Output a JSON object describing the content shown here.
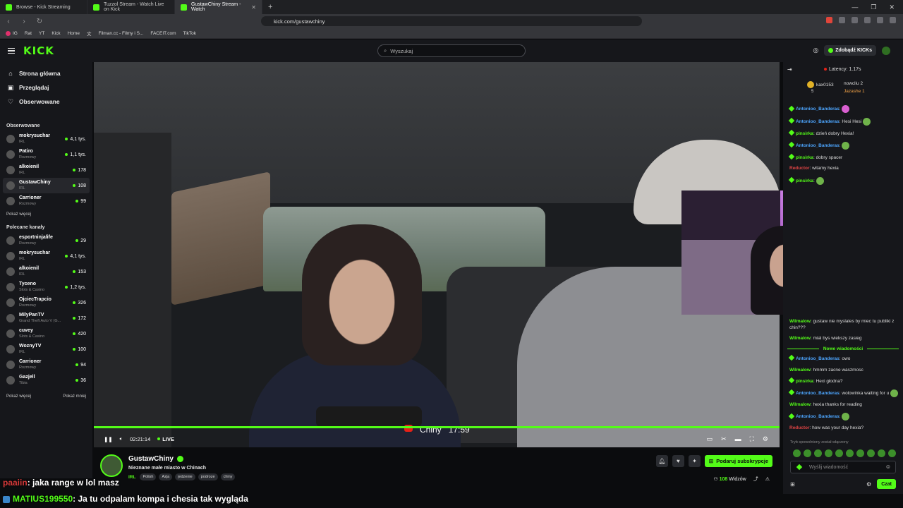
{
  "browser": {
    "tabs": [
      {
        "label": "Browse - Kick Streaming",
        "active": false
      },
      {
        "label": "Tuzzol Stream - Watch Live on Kick",
        "active": false
      },
      {
        "label": "GustawChiny Stream - Watch",
        "active": true
      }
    ],
    "url": "kick.com/gustawchiny",
    "bookmarks": [
      "IG",
      "Rat",
      "YT",
      "Kick",
      "Home",
      "文",
      "Filman.cc - Filmy i S...",
      "FACEIT.com",
      "TikTok"
    ]
  },
  "header": {
    "logo": "KICK",
    "search_placeholder": "Wyszukaj",
    "kicks_button": "Zdobądź KICKs"
  },
  "sidebar": {
    "nav": [
      {
        "label": "Strona główna",
        "icon": "home-icon"
      },
      {
        "label": "Przeglądaj",
        "icon": "browse-icon"
      },
      {
        "label": "Obserwowane",
        "icon": "heart-icon"
      }
    ],
    "followed_title": "Obserwowane",
    "followed": [
      {
        "name": "mokrysuchar",
        "category": "IRL",
        "viewers": "4,1 tys."
      },
      {
        "name": "Patiro",
        "category": "Rozmowy",
        "viewers": "1,1 tys."
      },
      {
        "name": "alkoienil",
        "category": "IRL",
        "viewers": "178"
      },
      {
        "name": "GustawChiny",
        "category": "IRL",
        "viewers": "108"
      },
      {
        "name": "Carrioner",
        "category": "Rozmowy",
        "viewers": "99"
      }
    ],
    "show_more_1": "Pokaż więcej",
    "recommended_title": "Polecane kanały",
    "recommended": [
      {
        "name": "esportninjalife",
        "category": "Rozmowy",
        "viewers": "29"
      },
      {
        "name": "mokrysuchar",
        "category": "IRL",
        "viewers": "4,1 tys."
      },
      {
        "name": "alkoienil",
        "category": "IRL",
        "viewers": "153"
      },
      {
        "name": "Tyceno",
        "category": "Slots & Casino",
        "viewers": "1,2 tys."
      },
      {
        "name": "OjciecTrapcio",
        "category": "Rozmowy",
        "viewers": "326"
      },
      {
        "name": "MilyPanTV",
        "category": "Grand Theft Auto V (G...",
        "viewers": "172"
      },
      {
        "name": "cuvey",
        "category": "Slots & Casino",
        "viewers": "420"
      },
      {
        "name": "WoznyTV",
        "category": "IRL",
        "viewers": "100"
      },
      {
        "name": "Carrioner",
        "category": "Rozmowy",
        "viewers": "94"
      },
      {
        "name": "Gazjell",
        "category": "Tibia",
        "viewers": "36"
      }
    ],
    "show_more_2": "Pokaż więcej",
    "show_less": "Pokaż mniej"
  },
  "player": {
    "time": "02:21:14",
    "live": "LIVE",
    "overlay_location": "Chiny",
    "overlay_clock": "17:59",
    "progress": 1.0
  },
  "stream": {
    "streamer": "GustawChiny",
    "title": "Nieznane małe miasto w Chinach",
    "category": "IRL",
    "tags": [
      "Polish",
      "Azja",
      "jedzenie",
      "podroze",
      "chiny"
    ],
    "subscribe_button": "Podaruj subskrypcje",
    "viewers_count": "108",
    "viewers_label": "Widzów"
  },
  "chat": {
    "latency": "Latency: 1.17s",
    "leaderboard": [
      {
        "name": "kax0153",
        "count": "5"
      },
      {
        "name": "nowcliu",
        "count": "2"
      },
      {
        "name": "Jazashe",
        "count": "1"
      }
    ],
    "messages": [
      {
        "user": "Antonioo_Banderas",
        "text": "",
        "cls": "u-ab",
        "badge": true,
        "emote": "pink"
      },
      {
        "user": "Antonioo_Banderas",
        "text": "Hesi Hesi",
        "cls": "u-ab",
        "badge": true,
        "emote": "green"
      },
      {
        "user": "pinsirka",
        "text": "dzień dobry Hexia!",
        "cls": "u-ps",
        "badge": true,
        "emote": ""
      },
      {
        "user": "Antonioo_Banderas",
        "text": "",
        "cls": "u-ab",
        "badge": true,
        "emote": "green"
      },
      {
        "user": "pinsirka",
        "text": "dobry spacer",
        "cls": "u-ps",
        "badge": true,
        "emote": ""
      },
      {
        "user": "Reductor",
        "text": "witamy hexia",
        "cls": "u-rd",
        "badge": false,
        "emote": ""
      },
      {
        "user": "pinsirka",
        "text": "",
        "cls": "u-ps",
        "badge": true,
        "emote": "green"
      }
    ],
    "messages_after": [
      {
        "user": "Wilmalow",
        "text": "gustaw nie myslales by miec tu publiki z chin???",
        "cls": "u-wl",
        "badge": false,
        "emote": ""
      },
      {
        "user": "Wilmalow",
        "text": "mial bys wiekszy zasieg",
        "cls": "u-wl",
        "badge": false,
        "emote": ""
      }
    ],
    "new_messages_label": "Nowe wiadomości",
    "messages_new": [
      {
        "user": "Antonioo_Banderas",
        "text": "owo",
        "cls": "u-ab",
        "badge": true,
        "emote": ""
      },
      {
        "user": "Wilmalow",
        "text": "hmmm zacne waszmosc",
        "cls": "u-wl",
        "badge": false,
        "emote": ""
      },
      {
        "user": "pinsirka",
        "text": "Hexi głodna?",
        "cls": "u-ps",
        "badge": true,
        "emote": ""
      },
      {
        "user": "Antonioo_Banderas",
        "text": "wolowinka waiting for u",
        "cls": "u-ab",
        "badge": true,
        "emote": "green"
      },
      {
        "user": "Wilmalow",
        "text": "hexia thanks for reading",
        "cls": "u-wl",
        "badge": false,
        "emote": ""
      },
      {
        "user": "Antonioo_Banderas",
        "text": "",
        "cls": "u-ab",
        "badge": true,
        "emote": "green"
      },
      {
        "user": "Reductor",
        "text": "how was your day hexia?",
        "cls": "u-rd",
        "badge": false,
        "emote": ""
      }
    ],
    "slowmode_note": "Tryb spowolniony został włączony",
    "input_placeholder": "Wyślij wiadomość",
    "send_button": "Czat"
  },
  "overlay_chat": [
    {
      "user": "paaiin",
      "text": ": jaka range w lol masz"
    },
    {
      "user": "MATIUS199550",
      "text": ": Ja tu odpalam kompa i chesia tak wygląda"
    }
  ]
}
